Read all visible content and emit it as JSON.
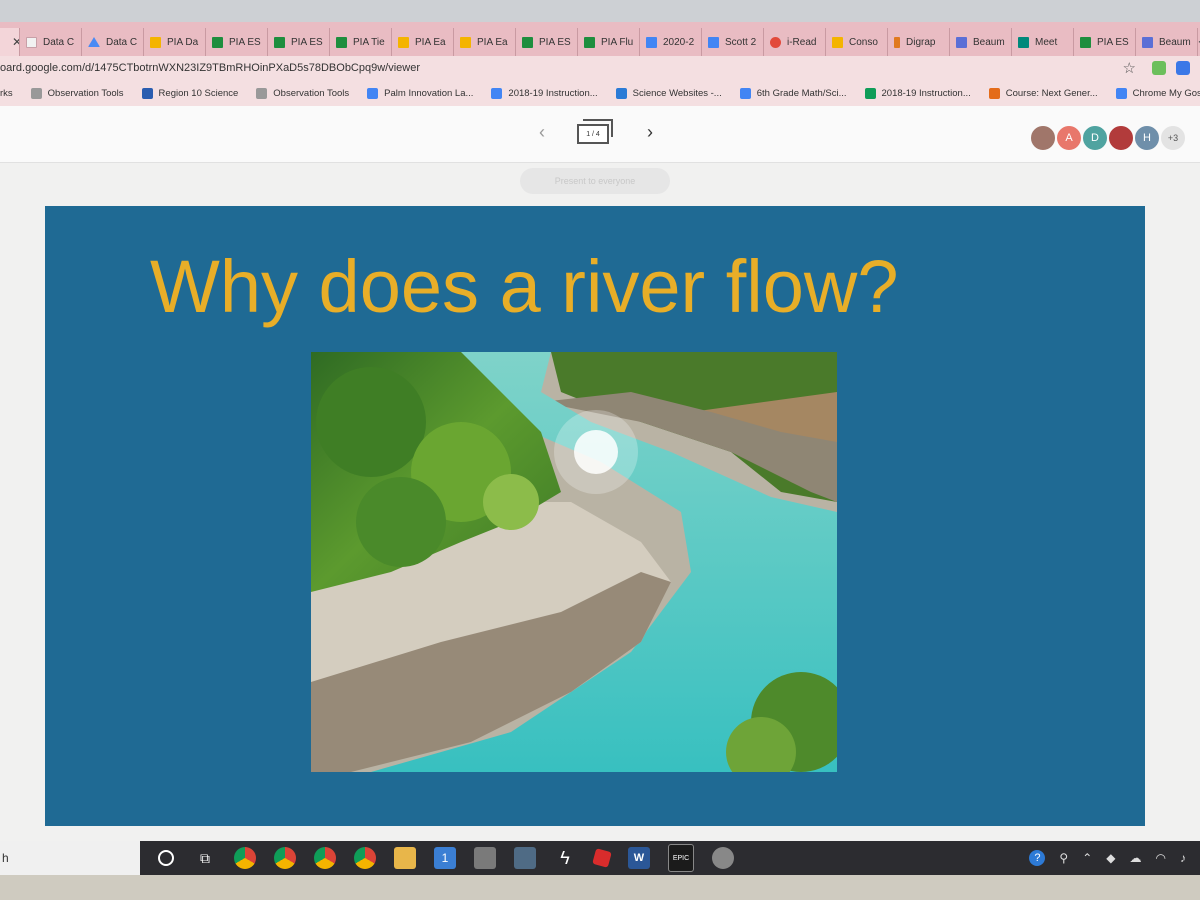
{
  "browser": {
    "tabs": [
      {
        "label": "",
        "icon": "tab-icon",
        "active": true,
        "closable": true
      },
      {
        "label": "Data C",
        "icon": "tab-icon"
      },
      {
        "label": "Data C",
        "icon": "drive-icon"
      },
      {
        "label": "PIA Da",
        "icon": "slides-icon"
      },
      {
        "label": "PIA ES",
        "icon": "sheets-icon"
      },
      {
        "label": "PIA ES",
        "icon": "sheets-icon"
      },
      {
        "label": "PIA Tie",
        "icon": "sheets-icon"
      },
      {
        "label": "PIA Ea",
        "icon": "slides-icon"
      },
      {
        "label": "PIA Ea",
        "icon": "slides-icon"
      },
      {
        "label": "PIA ES",
        "icon": "sheets-icon"
      },
      {
        "label": "PIA Flu",
        "icon": "sheets-icon"
      },
      {
        "label": "2020-2",
        "icon": "docs-icon"
      },
      {
        "label": "Scott 2",
        "icon": "docs-icon"
      },
      {
        "label": "i-Read",
        "icon": "ireader-icon"
      },
      {
        "label": "Conso",
        "icon": "slides-icon"
      },
      {
        "label": "Digrap",
        "icon": "digraph-icon"
      },
      {
        "label": "Beaum",
        "icon": "beaum-icon"
      },
      {
        "label": "Meet",
        "icon": "meet-icon"
      },
      {
        "label": "PIA ES",
        "icon": "sheets-icon"
      },
      {
        "label": "Beaum",
        "icon": "beaum-icon"
      }
    ],
    "new_tab": "+",
    "url": "oard.google.com/d/1475CTbotrnWXN23IZ9TBmRHOinPXaD5s78DBObCpq9w/viewer",
    "bookmarks": [
      {
        "label": "rks",
        "icon": "bookmark-icon"
      },
      {
        "label": "Observation Tools",
        "icon": "checkmark-icon"
      },
      {
        "label": "Region 10 Science",
        "icon": "region-icon"
      },
      {
        "label": "Observation Tools",
        "icon": "checkmark-icon"
      },
      {
        "label": "Palm Innovation La...",
        "icon": "docs-icon"
      },
      {
        "label": "2018-19 Instruction...",
        "icon": "docs-icon"
      },
      {
        "label": "Science Websites -...",
        "icon": "w-icon"
      },
      {
        "label": "6th Grade Math/Sci...",
        "icon": "docs-icon"
      },
      {
        "label": "2018-19 Instruction...",
        "icon": "drive-icon"
      },
      {
        "label": "Course: Next Gener...",
        "icon": "m-icon"
      },
      {
        "label": "Chrome My Gosh!",
        "icon": "docs-icon"
      }
    ]
  },
  "viewer": {
    "prev_label": "‹",
    "next_label": "›",
    "page_counter": "1 / 4",
    "present_label": "Present to everyone",
    "collaborators": [
      "",
      "A",
      "D",
      "",
      "H"
    ],
    "more_collaborators": "+3"
  },
  "slide": {
    "title": "Why does a river flow?",
    "image_alt": "river-photo",
    "colors": {
      "background": "#1f6a94",
      "title": "#e8ae28"
    }
  },
  "taskbar": {
    "search_text": "h",
    "word_label": "W",
    "epic_label": "EPIC",
    "mail_badge": "1",
    "help_label": "?"
  }
}
